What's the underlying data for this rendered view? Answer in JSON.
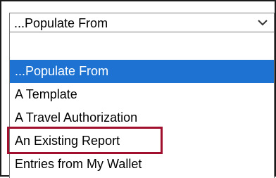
{
  "select": {
    "current_value": "...Populate From"
  },
  "dropdown": {
    "options": [
      {
        "label": "...Populate From",
        "selected": true
      },
      {
        "label": "A Template",
        "selected": false
      },
      {
        "label": "A Travel Authorization",
        "selected": false
      },
      {
        "label": "An Existing Report",
        "selected": false,
        "highlighted": true
      },
      {
        "label": "Entries from My Wallet",
        "selected": false
      }
    ]
  },
  "colors": {
    "selected_bg": "#1e73d2",
    "highlight_border": "#a0102e"
  },
  "icons": {
    "select_chevron": "chevron-down-icon"
  }
}
